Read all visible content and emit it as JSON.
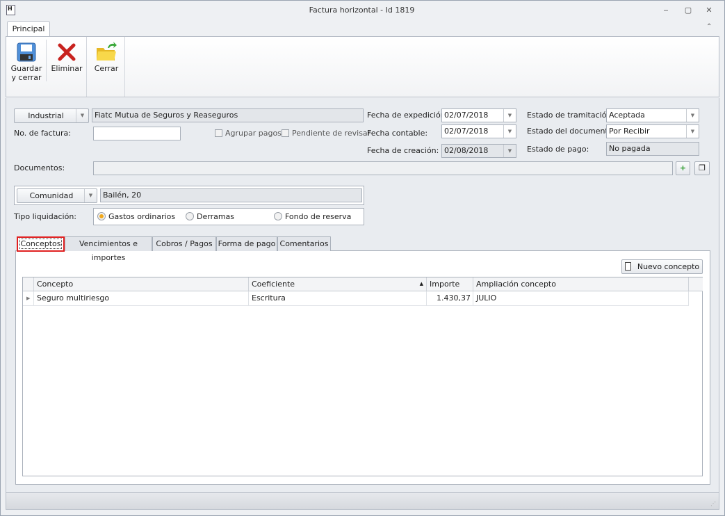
{
  "window": {
    "title": "Factura horizontal - Id 1819",
    "minimize": "‒",
    "restore": "▢",
    "close": "✕"
  },
  "ribbon": {
    "tab": "Principal",
    "collapse": "⌃",
    "buttons": [
      {
        "label1": "Guardar",
        "label2": "y cerrar"
      },
      {
        "label1": "Eliminar"
      },
      {
        "label1": "Cerrar"
      }
    ]
  },
  "form": {
    "tipo_proveedor": "Industrial",
    "proveedor": "Fiatc Mutua de Seguros y Reaseguros",
    "no_factura_label": "No. de factura:",
    "no_factura": "",
    "agrupar_pagos": "Agrupar pagos",
    "pendiente_revisar": "Pendiente de revisar",
    "fecha_expedicion_label": "Fecha de expedición:",
    "fecha_expedicion": "02/07/2018",
    "fecha_contable_label": "Fecha contable:",
    "fecha_contable": "02/07/2018",
    "fecha_creacion_label": "Fecha de creación:",
    "fecha_creacion": "02/08/2018",
    "estado_tramitacion_label": "Estado de tramitación:",
    "estado_tramitacion": "Aceptada",
    "estado_documento_label": "Estado del documento:",
    "estado_documento": "Por Recibir",
    "estado_pago_label": "Estado de pago:",
    "estado_pago": "No pagada",
    "documentos_label": "Documentos:",
    "documentos": "",
    "tipo_comunidad": "Comunidad",
    "comunidad": "Bailén, 20",
    "tipo_liquidacion_label": "Tipo liquidación:",
    "liquidacion_options": [
      "Gastos ordinarios",
      "Derramas",
      "Fondo de reserva"
    ],
    "liquidacion_selected": "Gastos ordinarios"
  },
  "tabs": [
    "Conceptos",
    "Vencimientos e importes",
    "Cobros / Pagos",
    "Forma de pago",
    "Comentarios"
  ],
  "active_tab": "Conceptos",
  "conceptos": {
    "nuevo_label": "Nuevo concepto",
    "columns": [
      "Concepto",
      "Coeficiente",
      "Importe",
      "Ampliación concepto"
    ],
    "sort_indicator": "▲",
    "rows": [
      {
        "concepto": "Seguro multiriesgo",
        "coeficiente": "Escritura",
        "importe": "1.430,37",
        "ampliacion": "JULIO"
      }
    ]
  }
}
